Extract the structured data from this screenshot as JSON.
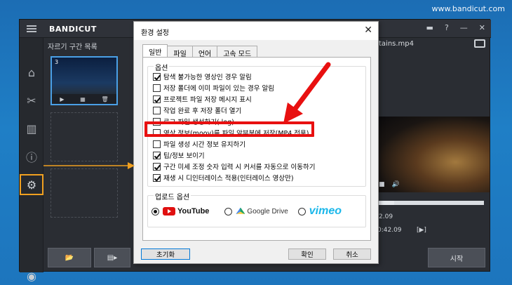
{
  "watermark": "www.bandicut.com",
  "app": {
    "logo": "BANDICUT",
    "panel_title": "자르기 구간 목록",
    "thumb_number": "3",
    "preview_title": "tains.mp4",
    "time_a": "2.09",
    "time_b": "0:42.09",
    "start_label": "시작",
    "top_icons": [
      "folder-icon",
      "help-icon",
      "minimize-icon",
      "close-icon"
    ],
    "accent": "#f0a020"
  },
  "dialog": {
    "title": "환경 설정",
    "close": "✕",
    "tabs": [
      "일반",
      "파일",
      "언어",
      "고속 모드"
    ],
    "options_label": "옵션",
    "options": [
      {
        "label": "탐색 불가능한 영상인 경우 알림",
        "checked": true
      },
      {
        "label": "저장 폴더에 이미 파일이 있는 경우 알림",
        "checked": false
      },
      {
        "label": "프로젝트 파일 저장 메시지 표시",
        "checked": true
      },
      {
        "label": "작업 완료 후 저장 폴더 열기",
        "checked": false
      },
      {
        "label": "로그 파일 생성하기(.log)",
        "checked": false
      },
      {
        "label": "영상 정보(moov)를 파일 앞부분에 저장(MP4 전용)",
        "checked": false
      },
      {
        "label": "파일 생성 시간 정보 유지하기",
        "checked": false
      },
      {
        "label": "팁/정보 보이기",
        "checked": true
      },
      {
        "label": "구간 미세 조정 숫자 입력 시 커서를 자동으로 이동하기",
        "checked": true
      },
      {
        "label": "재생 시 디인터레이스 적용(인터레이스 영상만)",
        "checked": true
      }
    ],
    "upload_label": "업로드 옵션",
    "upload": {
      "youtube": "YouTube",
      "gdrive": "Google Drive",
      "vimeo": "vimeo",
      "selected": "youtube"
    },
    "buttons": {
      "reset": "초기화",
      "ok": "확인",
      "cancel": "취소"
    }
  }
}
